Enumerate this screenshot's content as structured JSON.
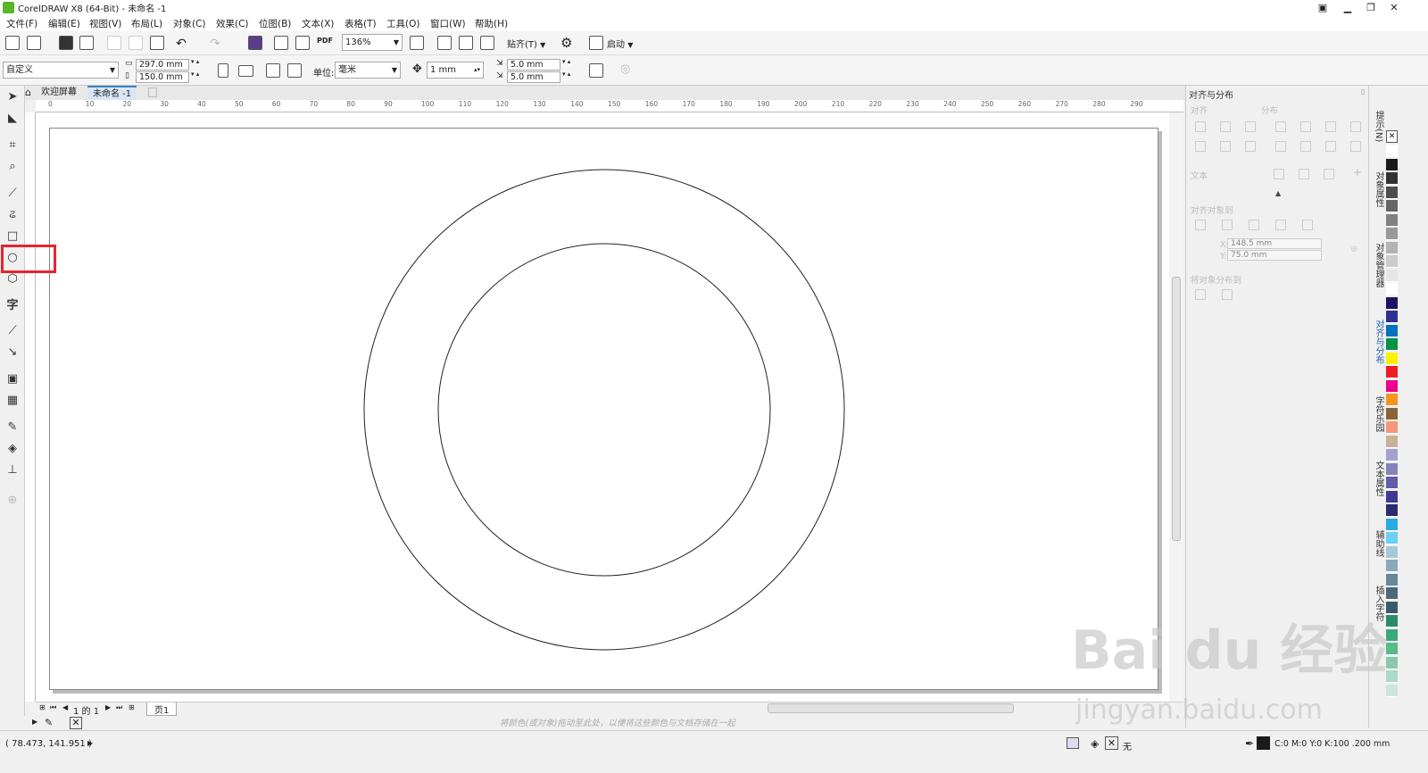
{
  "window": {
    "title": "CorelDRAW X8 (64-Bit) - 未命名 -1"
  },
  "menu": [
    "文件(F)",
    "编辑(E)",
    "视图(V)",
    "布局(L)",
    "对象(C)",
    "效果(C)",
    "位图(B)",
    "文本(X)",
    "表格(T)",
    "工具(O)",
    "窗口(W)",
    "帮助(H)"
  ],
  "toolbar1": {
    "pdf_label": "PDF",
    "zoom": "136%",
    "snap_label": "贴齐(T)",
    "launch_label": "启动"
  },
  "toolbar2": {
    "page_preset": "自定义",
    "width": "297.0 mm",
    "height": "150.0 mm",
    "unit_label": "单位:",
    "unit_value": "毫米",
    "nudge": "1 mm",
    "dup_x": "5.0 mm",
    "dup_y": "5.0 mm"
  },
  "tabs": {
    "welcome": "欢迎屏幕",
    "document": "未命名 -1"
  },
  "ruler": {
    "h_ticks": [
      "0",
      "10",
      "20",
      "30",
      "40",
      "50",
      "60",
      "70",
      "80",
      "90",
      "100",
      "110",
      "120",
      "130",
      "140",
      "150",
      "160",
      "170",
      "180",
      "190",
      "200",
      "210",
      "220",
      "230",
      "240",
      "250",
      "260",
      "270",
      "280",
      "290"
    ]
  },
  "pagenav": {
    "counter": "1 的 1",
    "page_tab": "页1"
  },
  "hint": "将颜色(或对象)拖动至此处，以便将这些颜色与文档存储在一起",
  "status": {
    "coords": "( 78.473, 141.951 )",
    "fill_none": "无",
    "outline_info": "C:0 M:0 Y:0 K:100  .200 mm"
  },
  "docker": {
    "title": "对齐与分布",
    "align_label": "对齐",
    "distribute_label": "分布",
    "text_label": "文本",
    "align_objects_label": "对齐对象到",
    "x_label": "X:",
    "x_value": "148.5 mm",
    "y_label": "Y:",
    "y_value": "75.0 mm",
    "distribute_to_label": "将对象分布到"
  },
  "docker_tabs": [
    "提示(N)",
    "对象属性",
    "对象管理器",
    "对齐与分布",
    "字符乐园",
    "文本属性",
    "辅助线",
    "插入字符"
  ],
  "palette": [
    "#ffffff",
    "#1a1a1a",
    "#333333",
    "#4d4d4d",
    "#666666",
    "#808080",
    "#999999",
    "#b3b3b3",
    "#cccccc",
    "#e6e6e6",
    "#ffffff",
    "#1b1464",
    "#2e3192",
    "#0071bc",
    "#009245",
    "#fff200",
    "#ed1c24",
    "#ec008c",
    "#f7941d",
    "#8c6239",
    "#f69679",
    "#c7b299",
    "#a3a0d0",
    "#8781bd",
    "#605ca8",
    "#3e3a94",
    "#2b2970",
    "#29abe2",
    "#6dcff6",
    "#a8c8d8",
    "#8aa9b8",
    "#668899",
    "#4a6a7a",
    "#3a5a6a",
    "#2a8a6a",
    "#3aaa7a",
    "#5aba8a",
    "#8acaaa",
    "#aadaca",
    "#cae6da"
  ],
  "watermark": {
    "main": "Bai du 经验",
    "sub": "jingyan.baidu.com"
  }
}
